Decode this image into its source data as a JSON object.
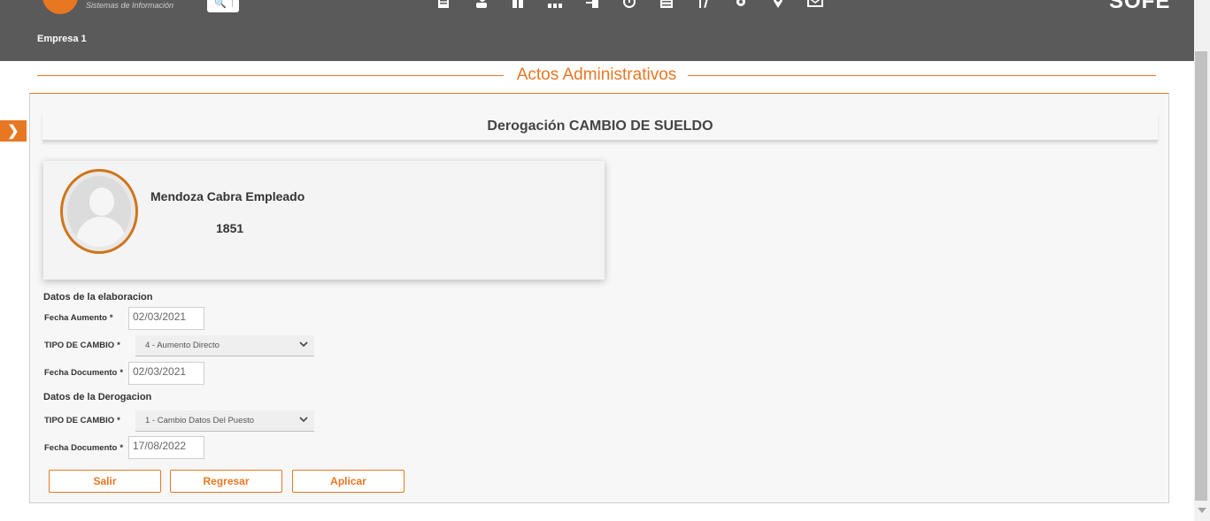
{
  "header": {
    "logo_subtitle": "Sistemas de Información",
    "company": "Empresa 1",
    "brand_text": "SOFE",
    "nav_icons": [
      "document-edit-icon",
      "users-icon",
      "gift-icon",
      "org-chart-icon",
      "transfer-icon",
      "history-icon",
      "list-icon",
      "tools-icon",
      "gear-icon",
      "location-icon",
      "message-icon"
    ]
  },
  "section": {
    "title": "Actos Administrativos"
  },
  "panel": {
    "heading": "Derogación CAMBIO DE SUELDO",
    "employee": {
      "name": "Mendoza Cabra Empleado",
      "id": "1851"
    },
    "elaboracion": {
      "title": "Datos de la elaboracion",
      "fecha_aumento_label": "Fecha Aumento",
      "fecha_aumento_value": "02/03/2021",
      "tipo_cambio_label": "TIPO DE CAMBIO",
      "tipo_cambio_value": "4 - Aumento Directo",
      "fecha_documento_label": "Fecha Documento",
      "fecha_documento_value": "02/03/2021"
    },
    "derogacion": {
      "title": "Datos de la Derogacion",
      "tipo_cambio_label": "TIPO DE CAMBIO",
      "tipo_cambio_value": "1 - Cambio Datos Del Puesto",
      "fecha_documento_label": "Fecha Documento",
      "fecha_documento_value": "17/08/2022"
    },
    "required_mark": "*",
    "buttons": {
      "exit": "Salir",
      "back": "Regresar",
      "apply": "Aplicar"
    }
  },
  "colors": {
    "accent": "#e87722",
    "header_bg": "#5a5a5a"
  }
}
